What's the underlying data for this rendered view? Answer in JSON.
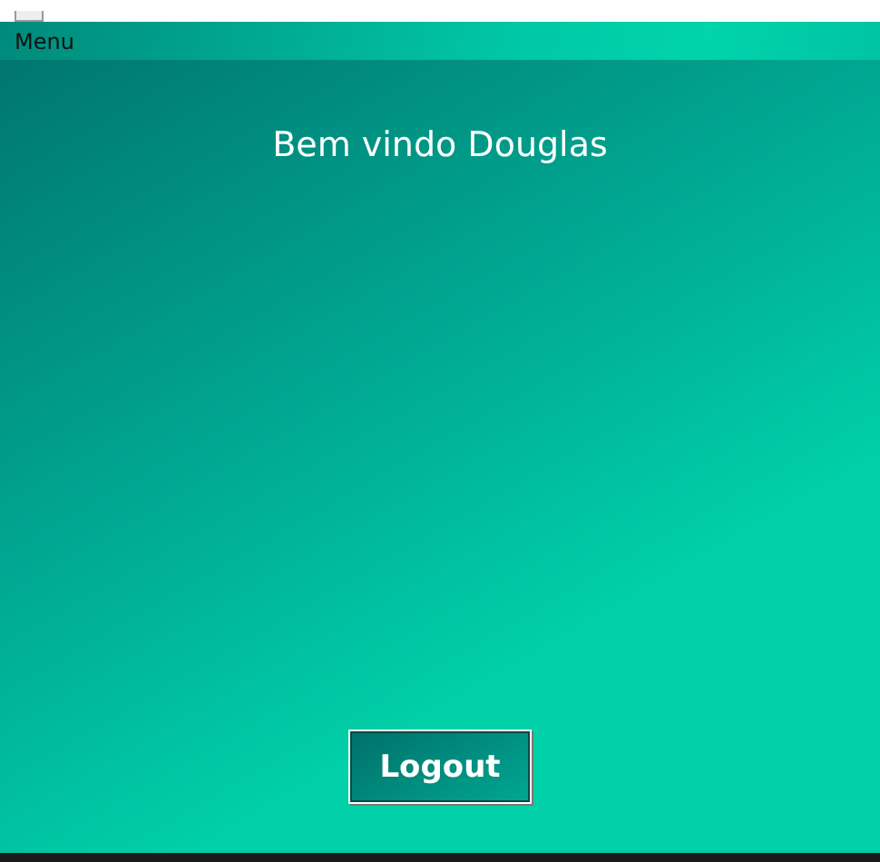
{
  "menu_bar": {
    "items": [
      {
        "label": "Menu"
      }
    ]
  },
  "welcome": "Bem vindo Douglas",
  "logout_button": "Logout"
}
